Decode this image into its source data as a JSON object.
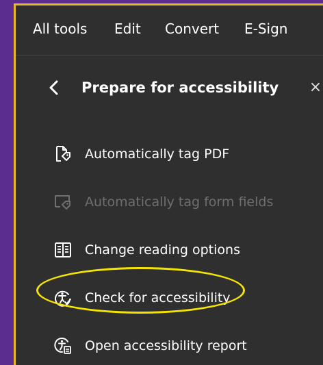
{
  "menubar": {
    "items": [
      {
        "label": "All tools"
      },
      {
        "label": "Edit"
      },
      {
        "label": "Convert"
      },
      {
        "label": "E-Sign"
      }
    ]
  },
  "panel": {
    "title": "Prepare for accessibility",
    "back_icon": "chevron-left-icon",
    "close_icon": "close-icon",
    "close_glyph": "×"
  },
  "tools": [
    {
      "label": "Automatically tag PDF",
      "icon": "tag-pdf-icon",
      "enabled": true
    },
    {
      "label": "Automatically tag form fields",
      "icon": "tag-form-fields-icon",
      "enabled": false
    },
    {
      "label": "Change reading options",
      "icon": "reading-options-icon",
      "enabled": true
    },
    {
      "label": "Check for accessibility",
      "icon": "accessibility-check-icon",
      "enabled": true,
      "highlighted": true
    },
    {
      "label": "Open accessibility report",
      "icon": "accessibility-report-icon",
      "enabled": true
    }
  ],
  "colors": {
    "background": "#5b2d8e",
    "panel": "#2f2f2f",
    "border_accent": "#e8b923",
    "highlight": "#f5e400",
    "text": "#ffffff",
    "disabled_text": "#6f6f6f"
  }
}
